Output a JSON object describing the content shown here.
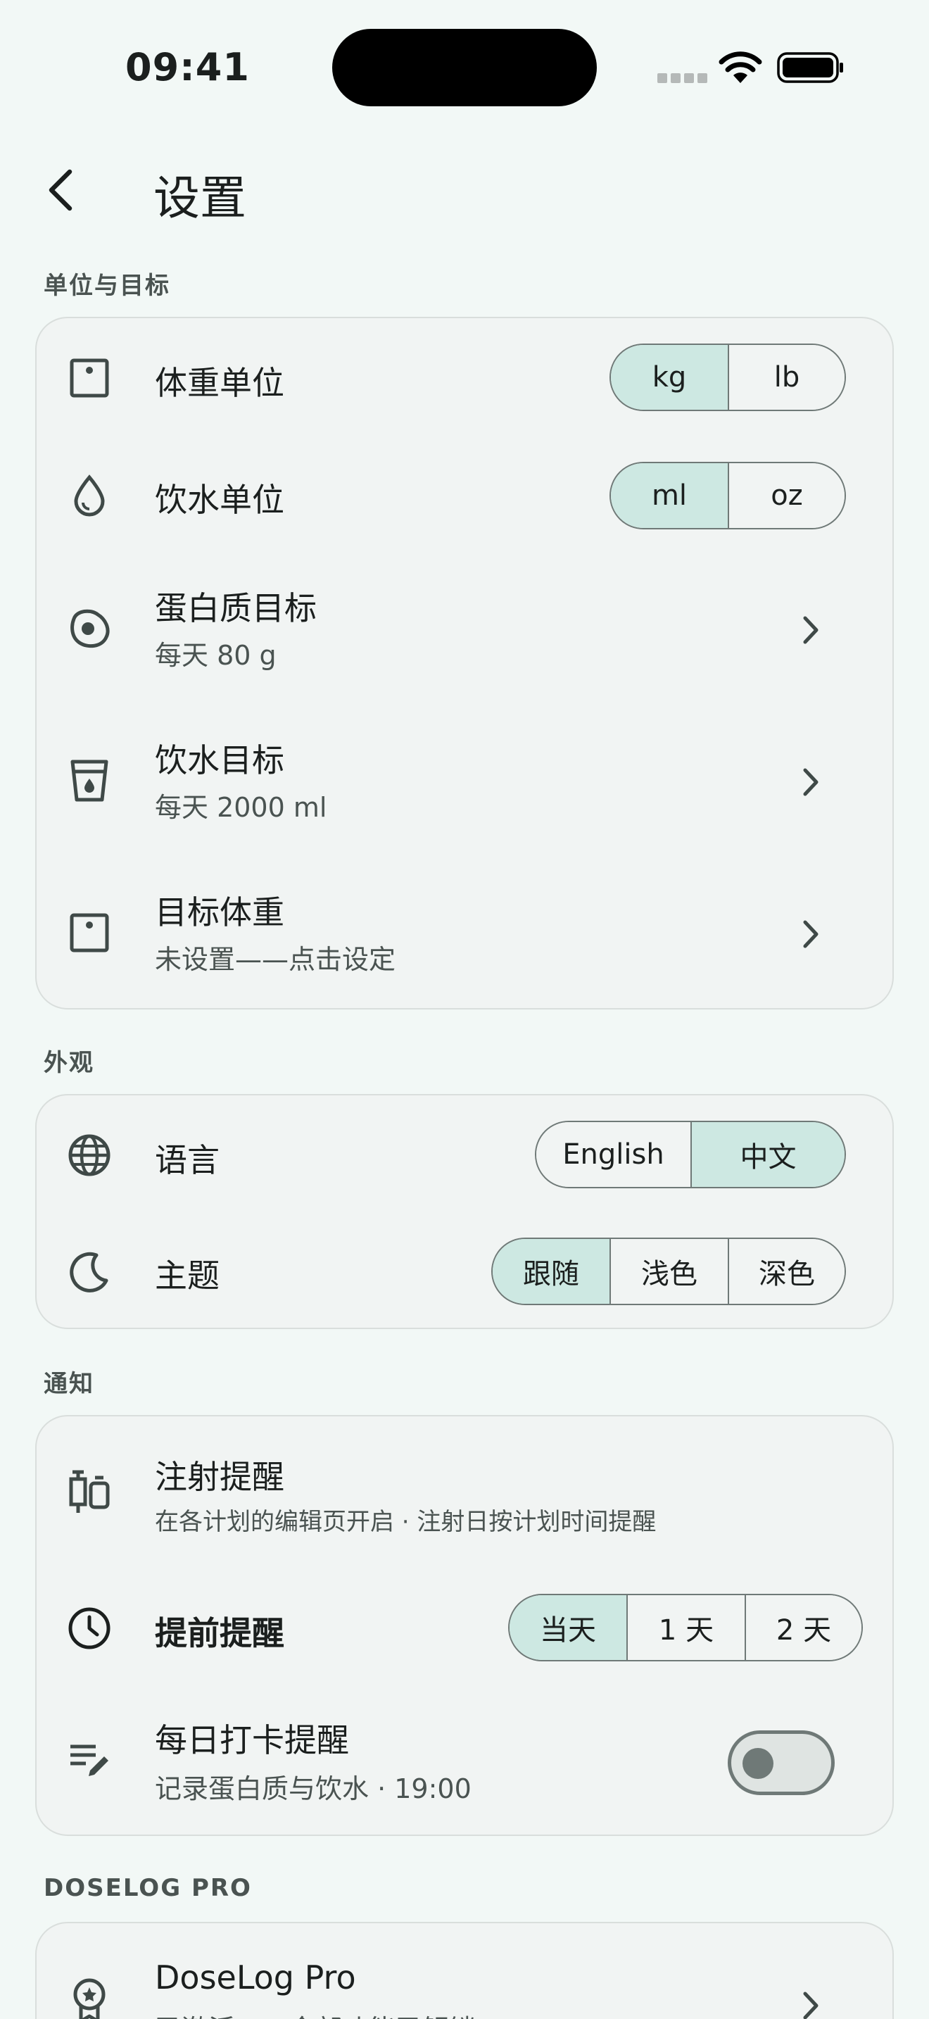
{
  "status_bar": {
    "time": "09:41"
  },
  "header": {
    "title": "设置"
  },
  "sections": {
    "units": {
      "label": "单位与目标"
    },
    "appearance": {
      "label": "外观"
    },
    "notifications": {
      "label": "通知"
    },
    "pro": {
      "label": "DOSELOG PRO"
    }
  },
  "units": {
    "weight_unit": {
      "label": "体重单位",
      "options": [
        "kg",
        "lb"
      ],
      "selected": "kg"
    },
    "water_unit": {
      "label": "饮水单位",
      "options": [
        "ml",
        "oz"
      ],
      "selected": "ml"
    },
    "protein_goal": {
      "label": "蛋白质目标",
      "value": "每天 80 g"
    },
    "water_goal": {
      "label": "饮水目标",
      "value": "每天 2000 ml"
    },
    "target_weight": {
      "label": "目标体重",
      "value": "未设置——点击设定"
    }
  },
  "appearance": {
    "language": {
      "label": "语言",
      "options": [
        "English",
        "中文"
      ],
      "selected": "中文"
    },
    "theme": {
      "label": "主题",
      "options": [
        "跟随",
        "浅色",
        "深色"
      ],
      "selected": "跟随"
    }
  },
  "notifications": {
    "injection": {
      "label": "注射提醒",
      "value": "在各计划的编辑页开启 · 注射日按计划时间提醒"
    },
    "advance": {
      "label": "提前提醒",
      "options": [
        "当天",
        "1 天",
        "2 天"
      ],
      "selected": "当天"
    },
    "daily": {
      "label": "每日打卡提醒",
      "value": "记录蛋白质与饮水 · 19:00",
      "enabled": false
    }
  },
  "pro": {
    "title": "DoseLog Pro",
    "value": "已激活——全部功能已解锁"
  },
  "colors": {
    "accent_selected": "#cde8e2",
    "background": "#f2f8f6",
    "card": "#f1f4f3"
  }
}
